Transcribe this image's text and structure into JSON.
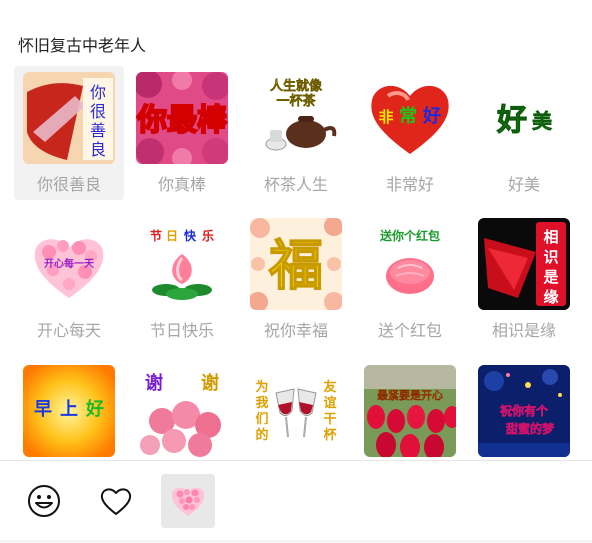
{
  "pack": {
    "title": "怀旧复古中老年人"
  },
  "stickers": [
    {
      "label": "你很善良",
      "art_text": "你很善良"
    },
    {
      "label": "你真棒",
      "art_text": "你最棒"
    },
    {
      "label": "杯茶人生",
      "art_text": "人生就像一杯茶"
    },
    {
      "label": "非常好",
      "art_text": "非常好"
    },
    {
      "label": "好美",
      "art_text": "好美"
    },
    {
      "label": "开心每天",
      "art_text": "开心每一天"
    },
    {
      "label": "节日快乐",
      "art_text": "节日快乐"
    },
    {
      "label": "祝你幸福",
      "art_text": "福"
    },
    {
      "label": "送个红包",
      "art_text": "送你个红包"
    },
    {
      "label": "相识是缘",
      "art_text": "相识是缘"
    },
    {
      "label": "",
      "art_text": "早上好"
    },
    {
      "label": "",
      "art_text": "谢谢"
    },
    {
      "label": "",
      "art_text": "为我们的友谊干杯"
    },
    {
      "label": "",
      "art_text": "最紧要是开心"
    },
    {
      "label": "",
      "art_text": "祝你有个甜蜜的梦"
    }
  ],
  "tabs": [
    {
      "name": "emoji-tab",
      "icon": "smiley-icon"
    },
    {
      "name": "favorites-tab",
      "icon": "heart-outline-icon"
    },
    {
      "name": "sticker-pack-tab",
      "icon": "flower-heart-icon"
    }
  ],
  "colors": {
    "selected_bg": "#f2f2f2",
    "label": "#a6a6a6",
    "active_tab_bg": "#e8e8e8"
  }
}
